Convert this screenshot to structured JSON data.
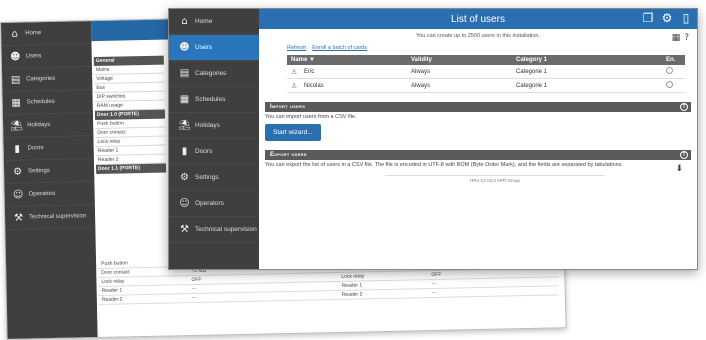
{
  "back_window": {
    "sidebar": [
      {
        "label": "Home",
        "icon": "home-icon",
        "glyph": "⌂"
      },
      {
        "label": "Users",
        "icon": "users-icon",
        "glyph": "☻"
      },
      {
        "label": "Categories",
        "icon": "categories-icon",
        "glyph": "▤"
      },
      {
        "label": "Schedules",
        "icon": "calendar-icon",
        "glyph": "▦"
      },
      {
        "label": "Holidays",
        "icon": "holidays-icon",
        "glyph": "⛱"
      },
      {
        "label": "Doors",
        "icon": "door-icon",
        "glyph": "▮"
      },
      {
        "label": "Settings",
        "icon": "gear-icon",
        "glyph": "⚙"
      },
      {
        "label": "Operators",
        "icon": "operators-icon",
        "glyph": "☺"
      },
      {
        "label": "Technical supervision",
        "icon": "wrench-icon",
        "glyph": "⚒"
      }
    ],
    "panel": {
      "general_header": "General",
      "general_rows": [
        "Mains",
        "Voltage",
        "Bus",
        "DIP switches",
        "RAM usage"
      ],
      "door10_header": "Door 1.0 (PORTE)",
      "door10_rows": [
        "Push button",
        "Door contact",
        "Lock relay",
        "Reader 1",
        "Reader 2"
      ],
      "door11_header": "Door 1.1 (PORTE)"
    },
    "bottom_table": [
      [
        "Push button",
        "OFF",
        "Push button",
        "OFF"
      ],
      [
        "Door contact",
        ">1 MΩ",
        "Door contact",
        "OFF (door closed)"
      ],
      [
        "Lock relay",
        "OFF",
        "Lock relay",
        "OFF"
      ],
      [
        "Reader 1",
        "—",
        "Reader 1",
        "—"
      ],
      [
        "Reader 2",
        "—",
        "Reader 2",
        "—"
      ]
    ]
  },
  "front_window": {
    "title": "List of users",
    "sidebar": [
      {
        "label": "Home",
        "icon": "home-icon",
        "glyph": "⌂"
      },
      {
        "label": "Users",
        "icon": "users-icon",
        "glyph": "☻",
        "active": true
      },
      {
        "label": "Categories",
        "icon": "categories-icon",
        "glyph": "▤"
      },
      {
        "label": "Schedules",
        "icon": "calendar-icon",
        "glyph": "▦"
      },
      {
        "label": "Holidays",
        "icon": "holidays-icon",
        "glyph": "⛱"
      },
      {
        "label": "Doors",
        "icon": "door-icon",
        "glyph": "▮"
      },
      {
        "label": "Settings",
        "icon": "gear-icon",
        "glyph": "⚙"
      },
      {
        "label": "Operators",
        "icon": "operators-icon",
        "glyph": "☺"
      },
      {
        "label": "Technical supervision",
        "icon": "wrench-icon",
        "glyph": "⚒"
      }
    ],
    "note": "You can create up to 2500 users in this installation.",
    "links": {
      "refresh": "Refresh",
      "enroll": "Enroll a batch of cards"
    },
    "table": {
      "headers": [
        "Name ▼",
        "Validity",
        "Category 1",
        "En."
      ],
      "rows": [
        [
          "Eric",
          "Always",
          "Categorie 1"
        ],
        [
          "Nicolas",
          "Always",
          "Categorie 1"
        ]
      ]
    },
    "import": {
      "header": "Import users",
      "text": "You can import users from a CSV file.",
      "button": "Start wizard..."
    },
    "export": {
      "header": "Export users",
      "text": "You can export the list of users in a CSV file. The file is encoded in UTF-8 with BOM (Byte Order Mark), and the fields are separated by tabulations."
    },
    "footer": "HR4 V2.02.0 APR Group"
  },
  "colors": {
    "sidebar": "#3f3f3f",
    "accent": "#2b6fb3",
    "table_header": "#6b6b6b"
  }
}
